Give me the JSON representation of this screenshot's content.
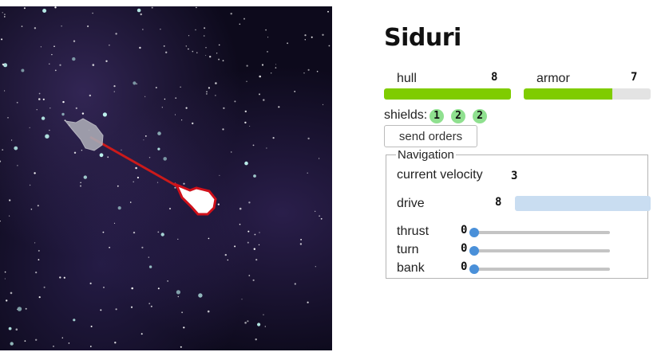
{
  "ship_name": "Siduri",
  "stats": {
    "hull": {
      "label": "hull",
      "value": "8",
      "fill": 1.0
    },
    "armor": {
      "label": "armor",
      "value": "7",
      "fill": 0.7
    }
  },
  "shields": {
    "label": "shields:",
    "values": [
      "1",
      "2",
      "2"
    ]
  },
  "send_orders_label": "send orders",
  "navigation": {
    "legend": "Navigation",
    "velocity_label": "current velocity",
    "velocity_value": "3",
    "drive_label": "drive",
    "drive_value": "8",
    "controls": [
      {
        "label": "thrust",
        "value": "0"
      },
      {
        "label": "turn",
        "value": "0"
      },
      {
        "label": "bank",
        "value": "0"
      }
    ]
  },
  "colors": {
    "bar_fill": "#7fcc00",
    "shield_chip": "#8fe08f",
    "selected_ship_outline": "#d0101a",
    "target_line": "#cc1a1a",
    "slider_thumb": "#4a90d9",
    "drive_track": "#c9ddf1"
  },
  "icons": {
    "player_ship": "ship-icon-selected",
    "enemy_ship": "ship-icon-grey"
  }
}
